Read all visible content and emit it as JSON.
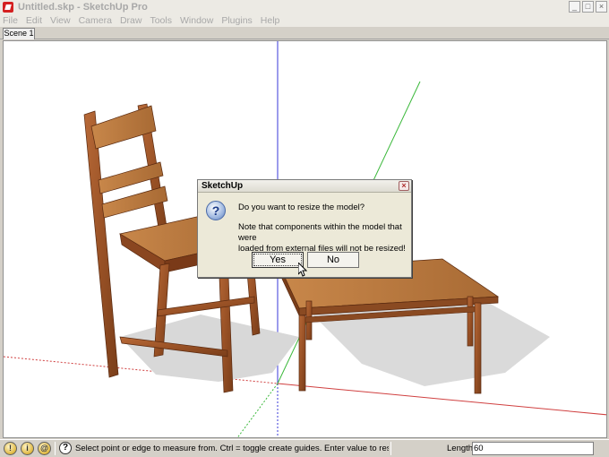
{
  "window": {
    "title": "Untitled.skp - SketchUp Pro",
    "minimize_glyph": "_",
    "maximize_glyph": "□",
    "close_glyph": "×"
  },
  "menu": [
    "File",
    "Edit",
    "View",
    "Camera",
    "Draw",
    "Tools",
    "Window",
    "Plugins",
    "Help"
  ],
  "scene_tabs": [
    "Scene 1"
  ],
  "dialog": {
    "title": "SketchUp",
    "question": "Do you want to resize the model?",
    "note_line1": "Note that components within the model that were",
    "note_line2": "loaded from external files will not be resized!",
    "yes_label": "Yes",
    "no_label": "No",
    "icon": "question-icon",
    "close_glyph": "×"
  },
  "status": {
    "message": "Select point or edge to measure from.  Ctrl = toggle create guides.  Enter value to resize model.",
    "length_label": "Length",
    "length_value": "60",
    "icons": [
      "geo-location-icon",
      "credits-icon",
      "user-icon",
      "help-icon"
    ]
  },
  "colors": {
    "blue_axis": "#3a3ad8",
    "green_axis": "#3ab83a",
    "red_axis": "#d04040",
    "wood": "#a0582a"
  }
}
